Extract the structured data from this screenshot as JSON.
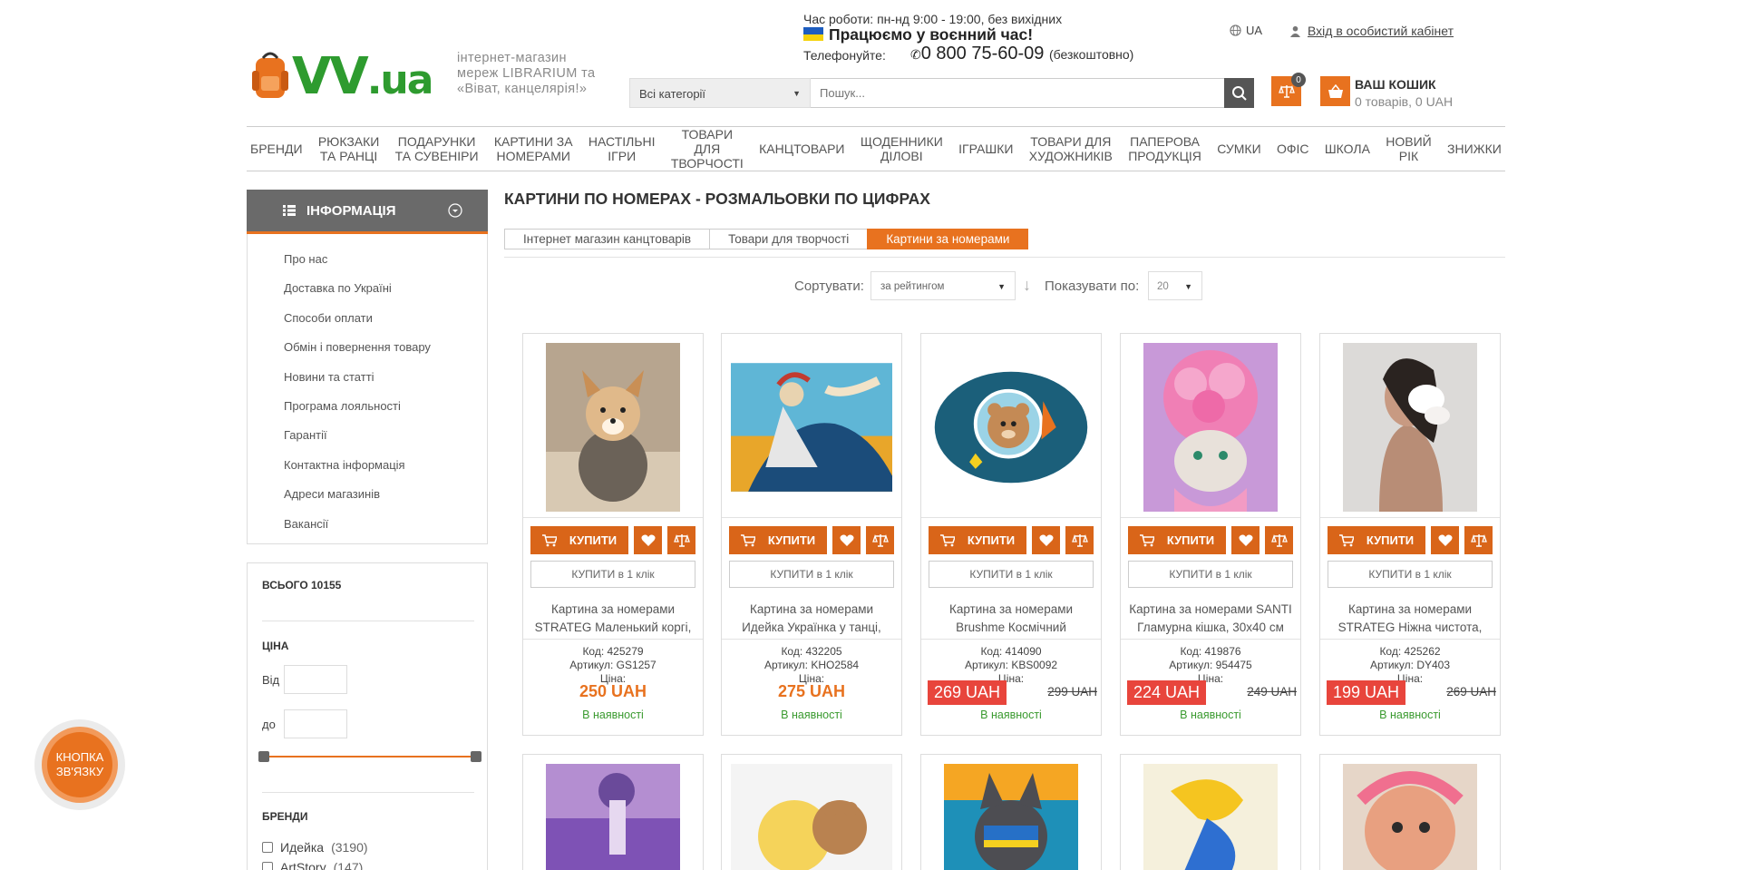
{
  "header": {
    "logo_tagline": "інтернет-магазин мереж LIBRARIUM та «Віват, канцелярія!»",
    "hours": "Час роботи: пн-нд 9:00 - 19:00, без вихідних",
    "war_notice": "Працюємо у воєнний час!",
    "phone_label": "Телефонуйте:",
    "phone": "0 800 75-60-09",
    "phone_note": "(безкоштовно)",
    "lang": "UA",
    "login": "Вхід в особистий кабінет",
    "category_select": "Всі категорії",
    "search_placeholder": "Пошук...",
    "compare_count": "0",
    "cart_title": "ВАШ КОШИК",
    "cart_sub": "0 товарів, 0 UAH"
  },
  "nav": [
    "БРЕНДИ",
    "РЮКЗАКИ\nТА РАНЦІ",
    "ПОДАРУНКИ\nТА СУВЕНІРИ",
    "КАРТИНИ ЗА\nНОМЕРАМИ",
    "НАСТІЛЬНІ\nІГРИ",
    "ТОВАРИ\nДЛЯ\nТВОРЧОСТІ",
    "КАНЦТОВАРИ",
    "ЩОДЕННИКИ\nДІЛОВІ",
    "ІГРАШКИ",
    "ТОВАРИ ДЛЯ\nХУДОЖНИКІВ",
    "ПАПЕРОВА\nПРОДУКЦІЯ",
    "СУМКИ",
    "ОФІС",
    "ШКОЛА",
    "НОВИЙ\nРІК",
    "ЗНИЖКИ"
  ],
  "sidebar": {
    "info_title": "ІНФОРМАЦІЯ",
    "links": [
      "Про нас",
      "Доставка по Україні",
      "Способи оплати",
      "Обмін і повернення товару",
      "Новини та статті",
      "Програма лояльності",
      "Гарантії",
      "Контактна інформація",
      "Адреси магазинів",
      "Вакансії"
    ],
    "total": "ВСЬОГО 10155",
    "price_title": "ЦІНА",
    "from": "Від",
    "to": "до",
    "brands_title": "БРЕНДИ",
    "brands": [
      {
        "name": "Идейка",
        "count": "(3190)"
      },
      {
        "name": "ArtStory",
        "count": "(147)"
      }
    ]
  },
  "contact_button": "КНОПКА ЗВ'ЯЗКУ",
  "main": {
    "title": "КАРТИНИ ПО НОМЕРАХ - РОЗМАЛЬОВКИ ПО ЦИФРАХ",
    "breadcrumbs": [
      "Інтернет магазин канцтоварів",
      "Товари для творчості",
      "Картини за номерами"
    ],
    "sort_label": "Сортувати:",
    "sort_value": "за рейтингом",
    "show_label": "Показувати по:",
    "show_value": "20",
    "buy_label": "КУПИТИ",
    "one_click": "КУПИТИ в 1 клік",
    "price_label": "Ціна:",
    "in_stock": "В наявності",
    "products": [
      {
        "name": "Картина за номерами STRATEG Маленький коргі,",
        "code": "Код: 425279",
        "art": "Артикул: GS1257",
        "price": "250 UAH",
        "old": ""
      },
      {
        "name": "Картина за номерами Идейка Українка у танці,",
        "code": "Код: 432205",
        "art": "Артикул: KHO2584",
        "price": "275 UAH",
        "old": ""
      },
      {
        "name": "Картина за номерами Brushme Космічний",
        "code": "Код: 414090",
        "art": "Артикул: KBS0092",
        "price": "269 UAH",
        "old": "299 UAH"
      },
      {
        "name": "Картина за номерами SANTI Гламурна кішка, 30х40 см",
        "code": "Код: 419876",
        "art": "Артикул: 954475",
        "price": "224 UAH",
        "old": "249 UAH"
      },
      {
        "name": "Картина за номерами STRATEG Ніжна чистота,",
        "code": "Код: 425262",
        "art": "Артикул: DY403",
        "price": "199 UAH",
        "old": "269 UAH"
      }
    ]
  }
}
